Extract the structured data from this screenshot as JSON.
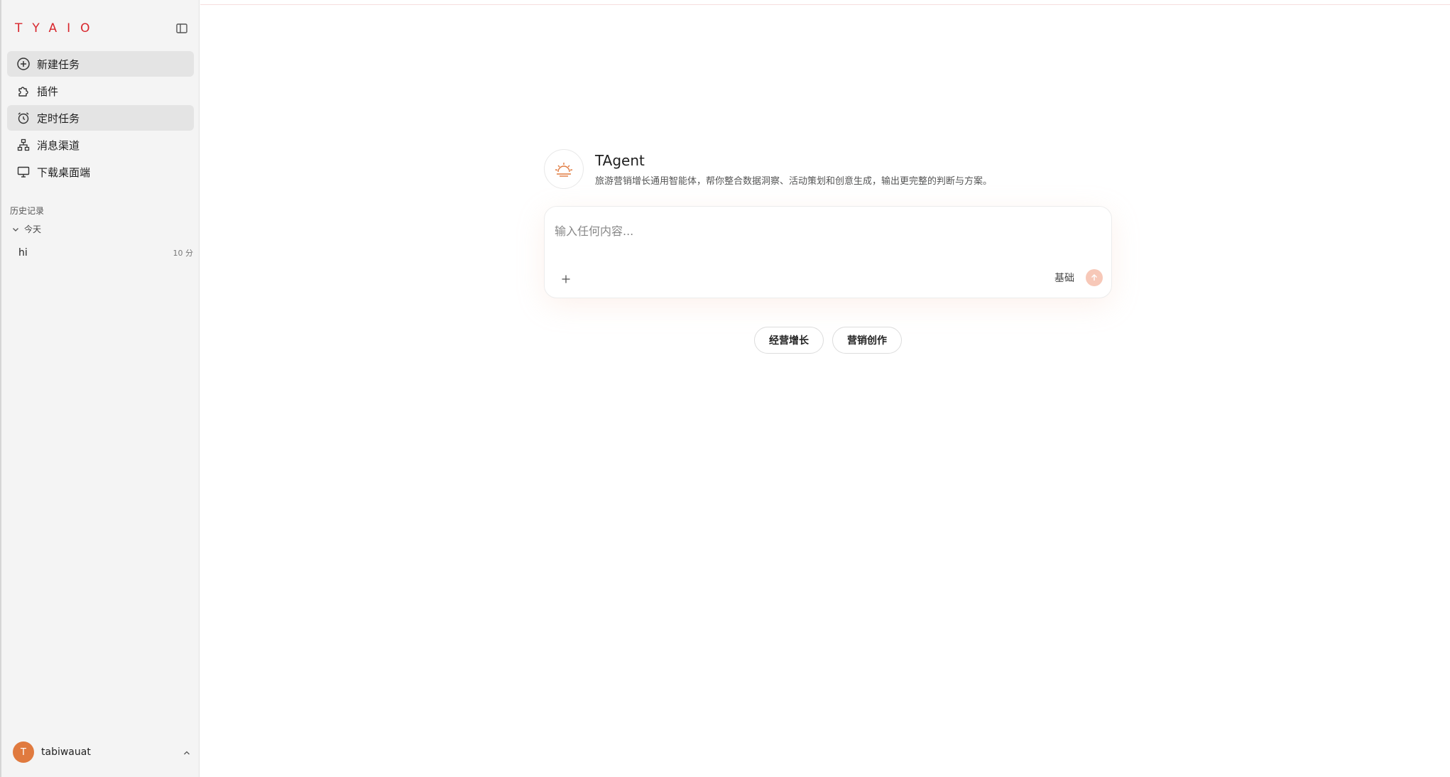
{
  "sidebar": {
    "logo": "TYAIO",
    "nav": [
      {
        "label": "新建任务",
        "icon": "plus-circle-icon"
      },
      {
        "label": "插件",
        "icon": "puzzle-icon"
      },
      {
        "label": "定时任务",
        "icon": "alarm-clock-icon"
      },
      {
        "label": "消息渠道",
        "icon": "network-icon"
      },
      {
        "label": "下载桌面端",
        "icon": "monitor-icon"
      }
    ],
    "history_title": "历史记录",
    "history_group": "今天",
    "history_items": [
      {
        "title": "hi",
        "time": "10 分"
      }
    ],
    "user": {
      "initial": "T",
      "name": "tabiwauat"
    }
  },
  "agent": {
    "name": "TAgent",
    "description": "旅游营销增长通用智能体，帮你整合数据洞察、活动策划和创意生成，输出更完整的判断与方案。"
  },
  "composer": {
    "placeholder": "输入任何内容...",
    "value": "",
    "mode": "基础"
  },
  "suggestions": [
    "经营增长",
    "营销创作"
  ],
  "colors": {
    "brand": "#d8262c",
    "accent": "#e07a3f",
    "send": "#f7c8b8"
  }
}
